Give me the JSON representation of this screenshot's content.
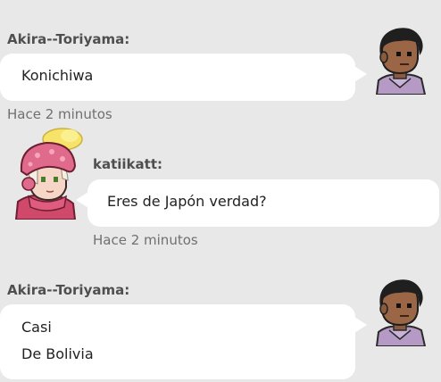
{
  "messages": [
    {
      "username": "Akira--Toriyama:",
      "lines": [
        "Konichiwa"
      ],
      "timestamp": "Hace 2 minutos",
      "avatar_icon": "male-avatar-icon"
    },
    {
      "username": "katiikatt:",
      "lines": [
        "Eres de Japón verdad?"
      ],
      "timestamp": "Hace 2 minutos",
      "avatar_icon": "female-avatar-pink-hat-icon"
    },
    {
      "username": "Akira--Toriyama:",
      "lines": [
        "Casi",
        "De Bolivia"
      ],
      "timestamp": "",
      "avatar_icon": "male-avatar-icon"
    }
  ],
  "colors": {
    "background": "#e8e8e8",
    "bubble": "#ffffff",
    "username": "#4f4f4f",
    "timestamp": "#707070"
  }
}
